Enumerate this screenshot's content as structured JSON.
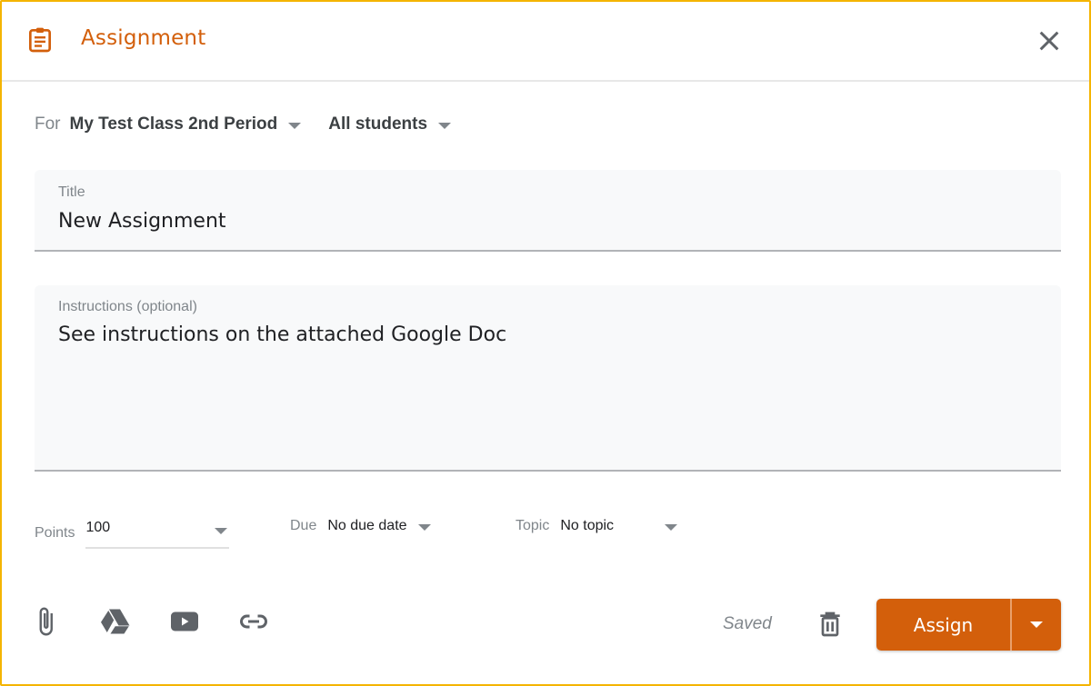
{
  "header": {
    "title": "Assignment",
    "icon": "assignment-clipboard-icon",
    "close_icon": "close-icon"
  },
  "for_row": {
    "label": "For",
    "class_selected": "My Test Class 2nd Period",
    "students_selected": "All students"
  },
  "title_field": {
    "label": "Title",
    "value": "New Assignment"
  },
  "instructions_field": {
    "label": "Instructions (optional)",
    "value": "See instructions on the attached Google Doc"
  },
  "points": {
    "label": "Points",
    "value": "100"
  },
  "due": {
    "label": "Due",
    "value": "No due date"
  },
  "topic": {
    "label": "Topic",
    "value": "No topic"
  },
  "attachments": [
    {
      "name": "paperclip-icon",
      "label": "Add file"
    },
    {
      "name": "google-drive-icon",
      "label": "Google Drive"
    },
    {
      "name": "youtube-icon",
      "label": "YouTube"
    },
    {
      "name": "link-icon",
      "label": "Link"
    }
  ],
  "footer": {
    "status": "Saved",
    "assign_label": "Assign"
  },
  "colors": {
    "accent": "#d35f0b",
    "frame_border": "#f4b400",
    "icon_gray": "#5f6368"
  }
}
